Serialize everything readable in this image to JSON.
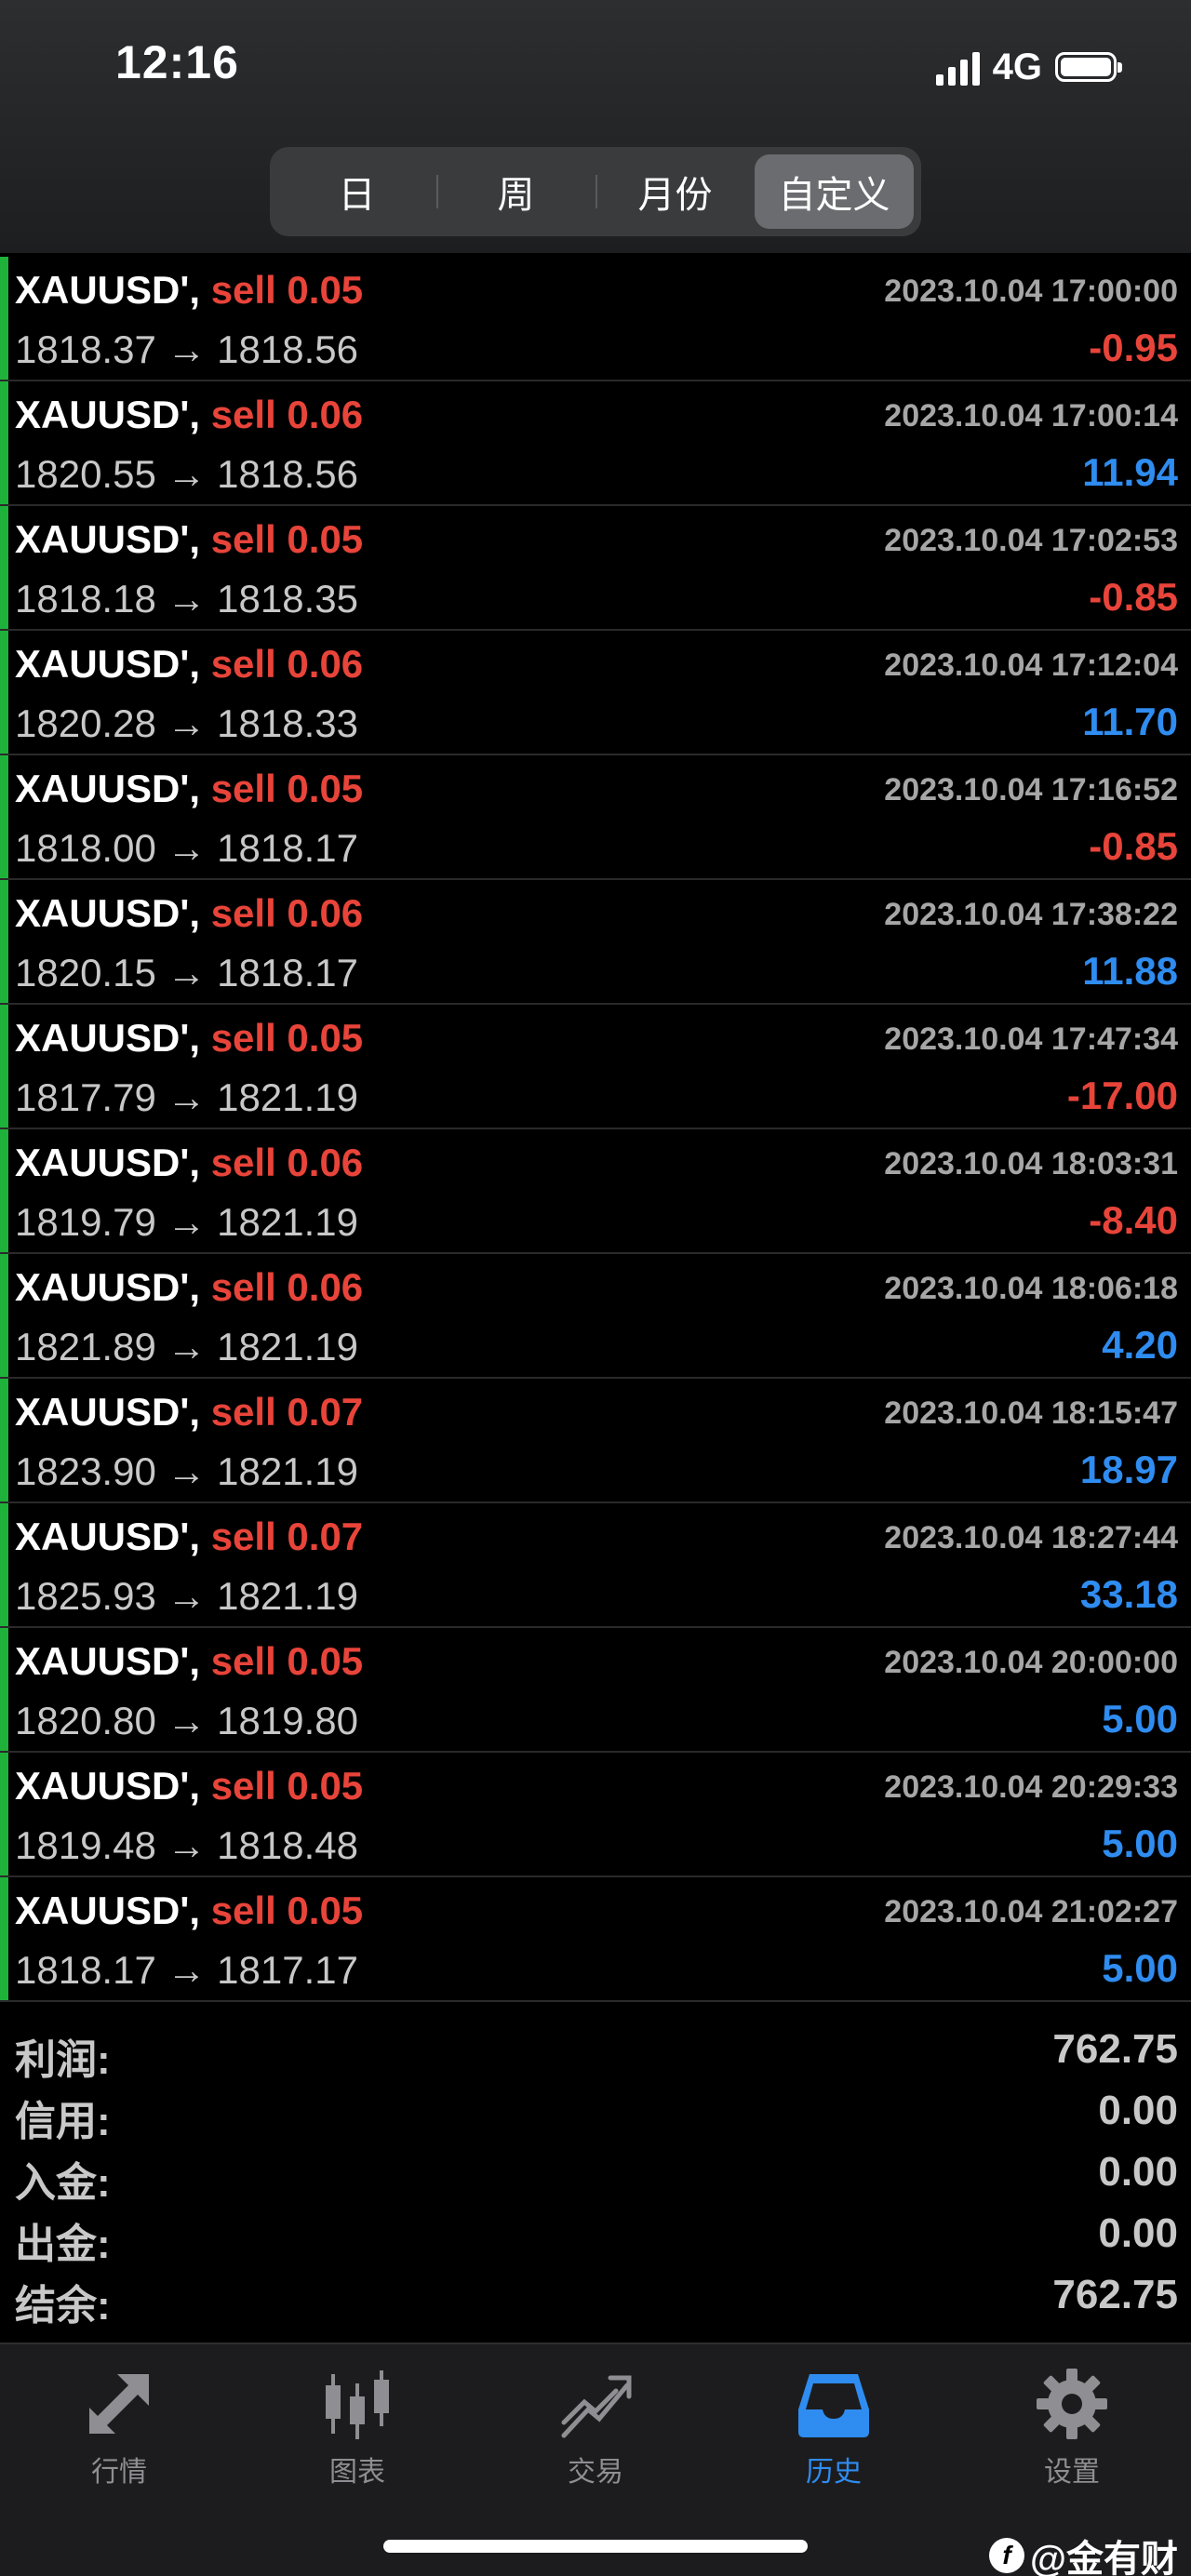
{
  "status_bar": {
    "time": "12:16",
    "network": "4G"
  },
  "period_tabs": [
    "日",
    "周",
    "月份",
    "自定义"
  ],
  "active_period": 3,
  "deals": [
    {
      "symbol": "XAUUSD'",
      "sep": ",",
      "type": "sell",
      "volume": "0.05",
      "open": "1818.37",
      "arrow": "→",
      "close": "1818.56",
      "time": "2023.10.04 17:00:00",
      "profit": "-0.95",
      "sign": "neg"
    },
    {
      "symbol": "XAUUSD'",
      "sep": ",",
      "type": "sell",
      "volume": "0.06",
      "open": "1820.55",
      "arrow": "→",
      "close": "1818.56",
      "time": "2023.10.04 17:00:14",
      "profit": "11.94",
      "sign": "pos"
    },
    {
      "symbol": "XAUUSD'",
      "sep": ",",
      "type": "sell",
      "volume": "0.05",
      "open": "1818.18",
      "arrow": "→",
      "close": "1818.35",
      "time": "2023.10.04 17:02:53",
      "profit": "-0.85",
      "sign": "neg"
    },
    {
      "symbol": "XAUUSD'",
      "sep": ",",
      "type": "sell",
      "volume": "0.06",
      "open": "1820.28",
      "arrow": "→",
      "close": "1818.33",
      "time": "2023.10.04 17:12:04",
      "profit": "11.70",
      "sign": "pos"
    },
    {
      "symbol": "XAUUSD'",
      "sep": ",",
      "type": "sell",
      "volume": "0.05",
      "open": "1818.00",
      "arrow": "→",
      "close": "1818.17",
      "time": "2023.10.04 17:16:52",
      "profit": "-0.85",
      "sign": "neg"
    },
    {
      "symbol": "XAUUSD'",
      "sep": ",",
      "type": "sell",
      "volume": "0.06",
      "open": "1820.15",
      "arrow": "→",
      "close": "1818.17",
      "time": "2023.10.04 17:38:22",
      "profit": "11.88",
      "sign": "pos"
    },
    {
      "symbol": "XAUUSD'",
      "sep": ",",
      "type": "sell",
      "volume": "0.05",
      "open": "1817.79",
      "arrow": "→",
      "close": "1821.19",
      "time": "2023.10.04 17:47:34",
      "profit": "-17.00",
      "sign": "neg"
    },
    {
      "symbol": "XAUUSD'",
      "sep": ",",
      "type": "sell",
      "volume": "0.06",
      "open": "1819.79",
      "arrow": "→",
      "close": "1821.19",
      "time": "2023.10.04 18:03:31",
      "profit": "-8.40",
      "sign": "neg"
    },
    {
      "symbol": "XAUUSD'",
      "sep": ",",
      "type": "sell",
      "volume": "0.06",
      "open": "1821.89",
      "arrow": "→",
      "close": "1821.19",
      "time": "2023.10.04 18:06:18",
      "profit": "4.20",
      "sign": "pos"
    },
    {
      "symbol": "XAUUSD'",
      "sep": ",",
      "type": "sell",
      "volume": "0.07",
      "open": "1823.90",
      "arrow": "→",
      "close": "1821.19",
      "time": "2023.10.04 18:15:47",
      "profit": "18.97",
      "sign": "pos"
    },
    {
      "symbol": "XAUUSD'",
      "sep": ",",
      "type": "sell",
      "volume": "0.07",
      "open": "1825.93",
      "arrow": "→",
      "close": "1821.19",
      "time": "2023.10.04 18:27:44",
      "profit": "33.18",
      "sign": "pos"
    },
    {
      "symbol": "XAUUSD'",
      "sep": ",",
      "type": "sell",
      "volume": "0.05",
      "open": "1820.80",
      "arrow": "→",
      "close": "1819.80",
      "time": "2023.10.04 20:00:00",
      "profit": "5.00",
      "sign": "pos"
    },
    {
      "symbol": "XAUUSD'",
      "sep": ",",
      "type": "sell",
      "volume": "0.05",
      "open": "1819.48",
      "arrow": "→",
      "close": "1818.48",
      "time": "2023.10.04 20:29:33",
      "profit": "5.00",
      "sign": "pos"
    },
    {
      "symbol": "XAUUSD'",
      "sep": ",",
      "type": "sell",
      "volume": "0.05",
      "open": "1818.17",
      "arrow": "→",
      "close": "1817.17",
      "time": "2023.10.04 21:02:27",
      "profit": "5.00",
      "sign": "pos"
    }
  ],
  "summary": [
    {
      "label": "利润:",
      "value": "762.75"
    },
    {
      "label": "信用:",
      "value": "0.00"
    },
    {
      "label": "入金:",
      "value": "0.00"
    },
    {
      "label": "出金:",
      "value": "0.00"
    },
    {
      "label": "结余:",
      "value": "762.75"
    }
  ],
  "tabbar": [
    {
      "label": "行情",
      "icon": "quotes-arrows-icon"
    },
    {
      "label": "图表",
      "icon": "candlestick-chart-icon"
    },
    {
      "label": "交易",
      "icon": "trade-trend-icon"
    },
    {
      "label": "历史",
      "icon": "history-inbox-icon"
    },
    {
      "label": "设置",
      "icon": "gear-icon"
    }
  ],
  "active_tab": 3,
  "watermark": "@金有财",
  "colors": {
    "positive": "#2f8cf0",
    "negative": "#e8443a",
    "accent_bar": "#1fb23a",
    "sell": "#e8443a"
  }
}
